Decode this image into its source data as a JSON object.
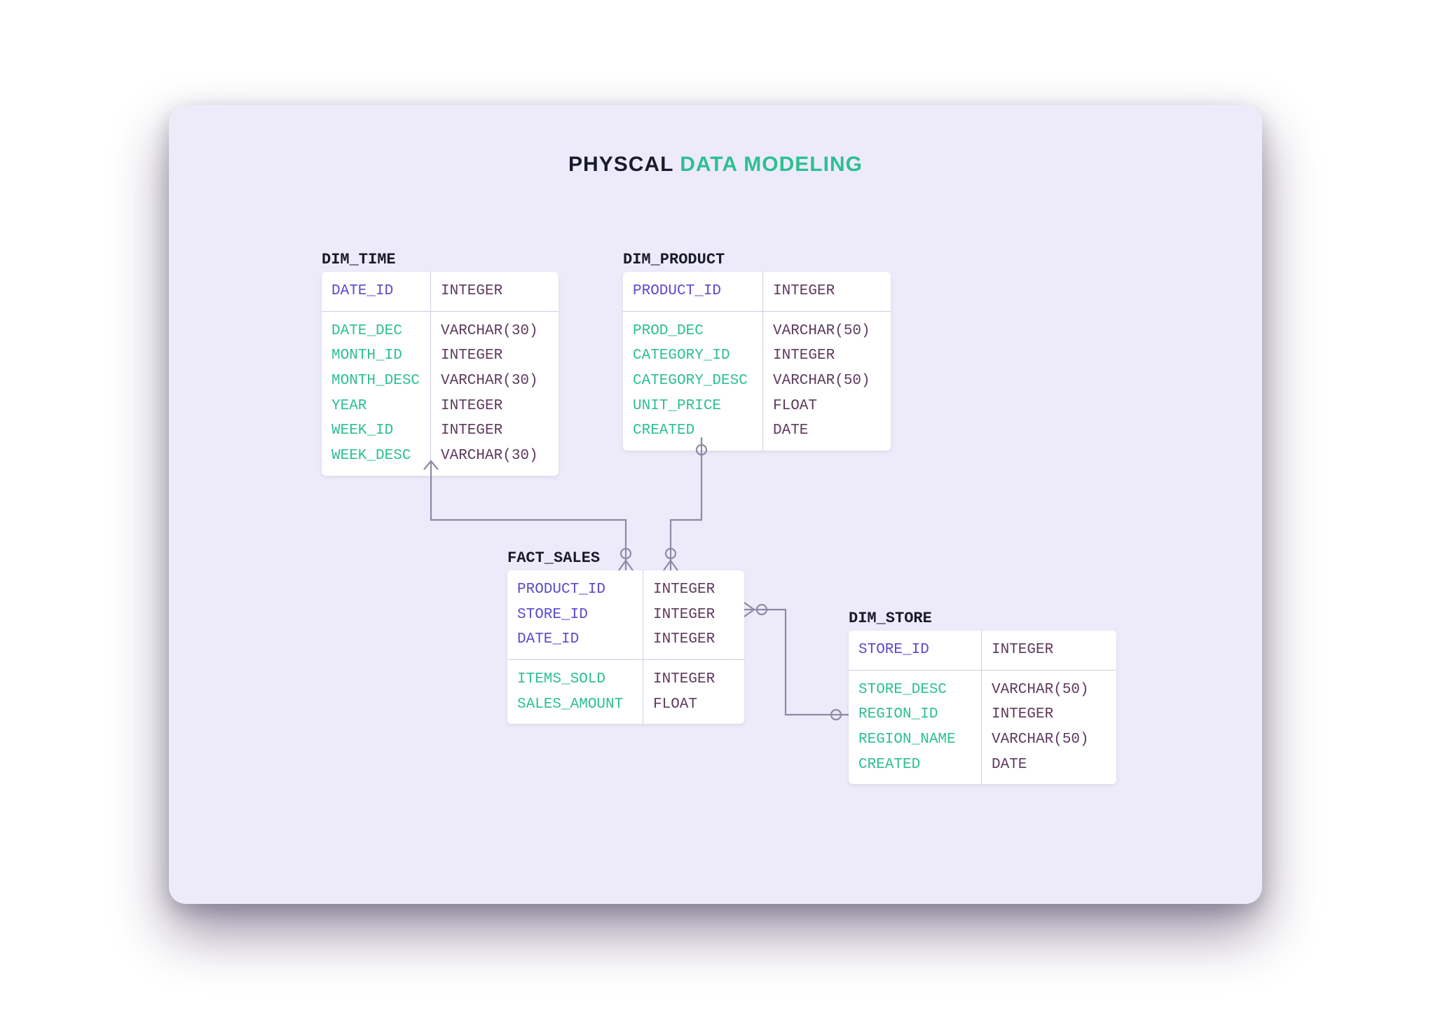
{
  "title": {
    "part1": "PHYSCAL",
    "part2": "DATA MODELING"
  },
  "colors": {
    "accent": "#2DBF93",
    "pk": "#5B4BCA",
    "type": "#5E3A5E"
  },
  "tables": {
    "dim_time": {
      "name": "DIM_TIME",
      "pk": [
        {
          "field": "DATE_ID",
          "type": "INTEGER"
        }
      ],
      "attrs": [
        {
          "field": "DATE_DEC",
          "type": "VARCHAR(30)"
        },
        {
          "field": "MONTH_ID",
          "type": "INTEGER"
        },
        {
          "field": "MONTH_DESC",
          "type": "VARCHAR(30)"
        },
        {
          "field": "YEAR",
          "type": "INTEGER"
        },
        {
          "field": "WEEK_ID",
          "type": "INTEGER"
        },
        {
          "field": "WEEK_DESC",
          "type": "VARCHAR(30)"
        }
      ]
    },
    "dim_product": {
      "name": "DIM_PRODUCT",
      "pk": [
        {
          "field": "PRODUCT_ID",
          "type": "INTEGER"
        }
      ],
      "attrs": [
        {
          "field": "PROD_DEC",
          "type": "VARCHAR(50)"
        },
        {
          "field": "CATEGORY_ID",
          "type": "INTEGER"
        },
        {
          "field": "CATEGORY_DESC",
          "type": "VARCHAR(50)"
        },
        {
          "field": "UNIT_PRICE",
          "type": "FLOAT"
        },
        {
          "field": "CREATED",
          "type": "DATE"
        }
      ]
    },
    "fact_sales": {
      "name": "FACT_SALES",
      "pk": [
        {
          "field": "PRODUCT_ID",
          "type": "INTEGER"
        },
        {
          "field": "STORE_ID",
          "type": "INTEGER"
        },
        {
          "field": "DATE_ID",
          "type": "INTEGER"
        }
      ],
      "attrs": [
        {
          "field": "ITEMS_SOLD",
          "type": "INTEGER"
        },
        {
          "field": "SALES_AMOUNT",
          "type": "FLOAT"
        }
      ]
    },
    "dim_store": {
      "name": "DIM_STORE",
      "pk": [
        {
          "field": "STORE_ID",
          "type": "INTEGER"
        }
      ],
      "attrs": [
        {
          "field": "STORE_DESC",
          "type": "VARCHAR(50)"
        },
        {
          "field": "REGION_ID",
          "type": "INTEGER"
        },
        {
          "field": "REGION_NAME",
          "type": "VARCHAR(50)"
        },
        {
          "field": "CREATED",
          "type": "DATE"
        }
      ]
    }
  }
}
